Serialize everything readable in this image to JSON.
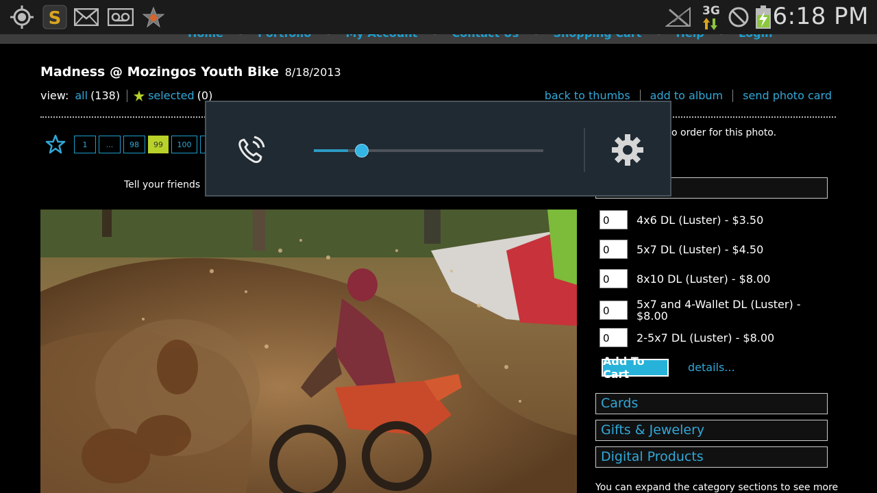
{
  "status_bar": {
    "left_icons": [
      "gps-icon",
      "app-s-icon",
      "mail-icon",
      "voicemail-icon",
      "star-app-icon"
    ],
    "network": "3G",
    "right_icons": [
      "signal-off-icon",
      "do-not-disturb-icon",
      "battery-charging-icon"
    ],
    "clock": "6:18 PM"
  },
  "nav": {
    "items": [
      "Home",
      "Portfolio",
      "My Account",
      "Contact Us",
      "Shopping Cart",
      "Help",
      "Login"
    ],
    "separator": "•"
  },
  "gallery": {
    "title": "Madness @ Mozingos Youth Bike",
    "date": "8/18/2013",
    "view_label": "view:",
    "all_label": "all",
    "all_count": "(138)",
    "selected_label": "selected",
    "selected_count": "(0)",
    "links": [
      "back to thumbs",
      "add to album",
      "send photo card"
    ]
  },
  "pager": {
    "pages": [
      "1",
      "...",
      "98",
      "99",
      "100",
      "..."
    ],
    "active": "99"
  },
  "tell_friends": "Tell your friends",
  "order_hint": "o order for this photo.",
  "prints": [
    {
      "qty": "0",
      "label": "4x6 DL (Luster) - $3.50"
    },
    {
      "qty": "0",
      "label": "5x7 DL (Luster) - $4.50"
    },
    {
      "qty": "0",
      "label": "8x10 DL (Luster) - $8.00"
    },
    {
      "qty": "0",
      "label": "5x7 and 4-Wallet DL (Luster) - $8.00"
    },
    {
      "qty": "0",
      "label": "2-5x7 DL (Luster) - $8.00"
    }
  ],
  "add_to_cart": "Add To Cart",
  "details": "details...",
  "categories": [
    "Cards",
    "Gifts & Jewelery",
    "Digital Products"
  ],
  "footer_text": "You can expand the category sections to see more",
  "volume_overlay": {
    "stream_icon": "phone-ring-icon",
    "level": 0.15,
    "settings_icon": "gear-icon"
  },
  "colors": {
    "accent": "#33b5e5",
    "link": "#32a8d8",
    "active_page": "#b8d22a",
    "overlay_bg": "#1f2a33"
  }
}
